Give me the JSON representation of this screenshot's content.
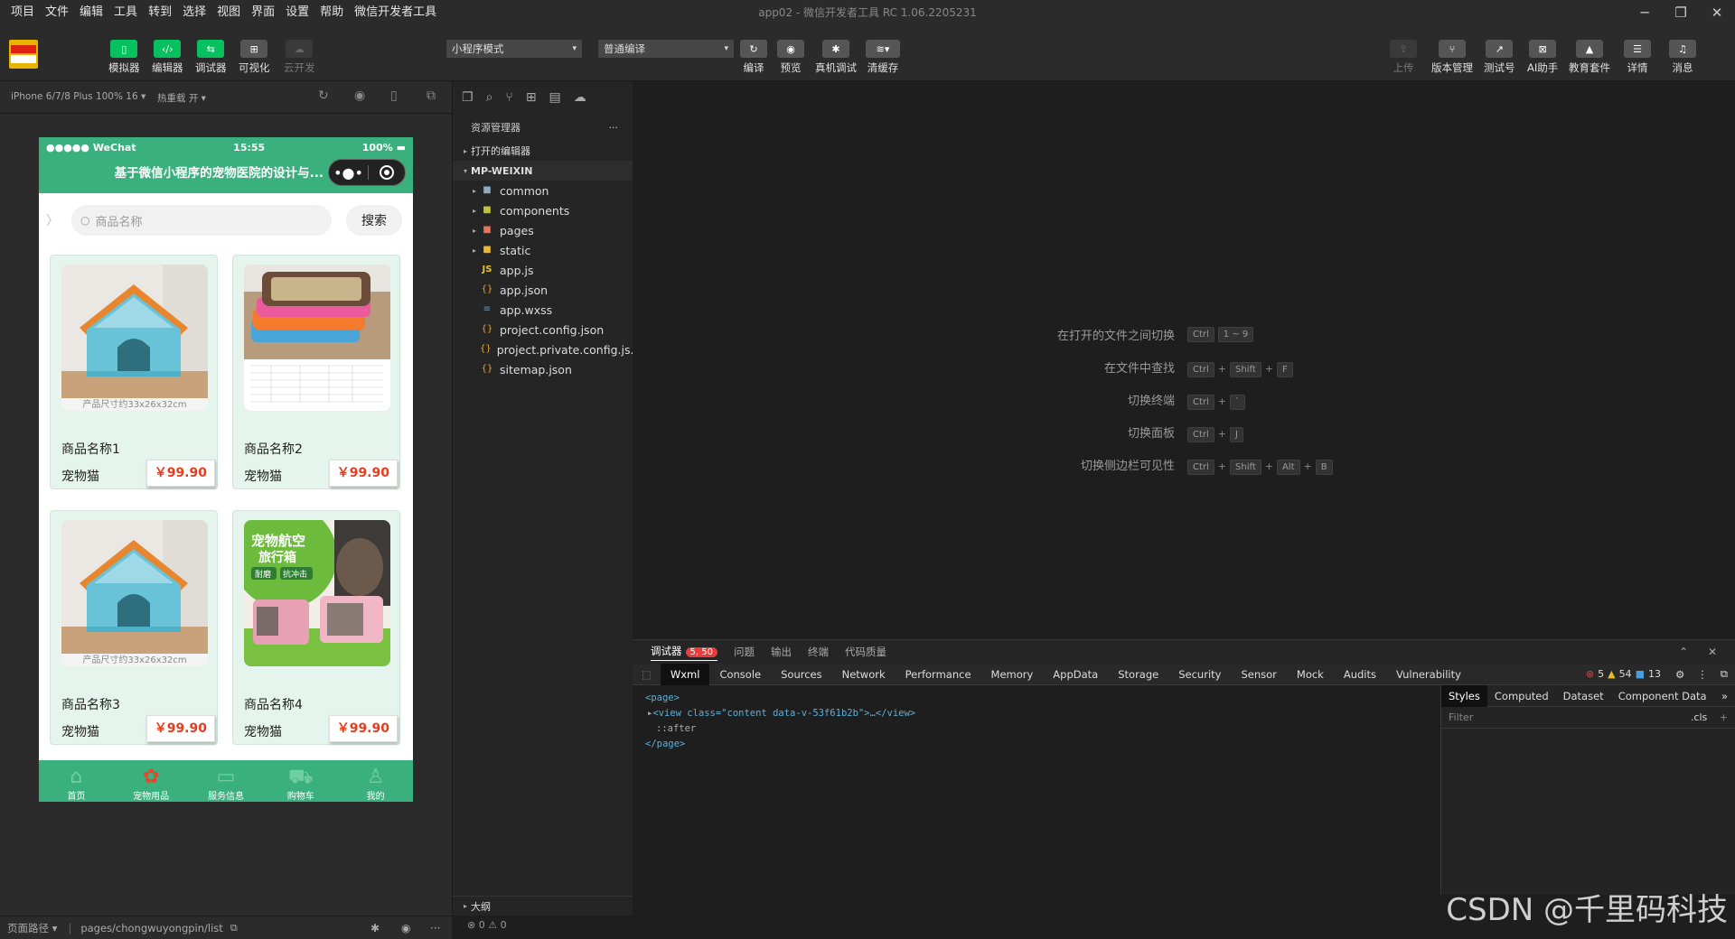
{
  "menubar": {
    "items": [
      "项目",
      "文件",
      "编辑",
      "工具",
      "转到",
      "选择",
      "视图",
      "界面",
      "设置",
      "帮助",
      "微信开发者工具"
    ],
    "window_title": "app02 - 微信开发者工具 RC 1.06.2205231"
  },
  "toolbar": {
    "left_buttons": [
      {
        "label": "模拟器",
        "icon": "phone-icon"
      },
      {
        "label": "编辑器",
        "icon": "code-icon"
      },
      {
        "label": "调试器",
        "icon": "debug-icon"
      },
      {
        "label": "可视化",
        "icon": "layout-icon"
      },
      {
        "label": "云开发",
        "icon": "cloud-icon"
      }
    ],
    "mode_select": "小程序模式",
    "compile_select": "普通编译",
    "mid_buttons": [
      {
        "label": "编译",
        "icon": "refresh-icon"
      },
      {
        "label": "预览",
        "icon": "eye-icon"
      },
      {
        "label": "真机调试",
        "icon": "bug-icon"
      },
      {
        "label": "清缓存",
        "icon": "layers-icon"
      }
    ],
    "right_buttons": [
      {
        "label": "上传",
        "icon": "upload-icon"
      },
      {
        "label": "版本管理",
        "icon": "branch-icon"
      },
      {
        "label": "测试号",
        "icon": "external-icon"
      },
      {
        "label": "AI助手",
        "icon": "ai-icon"
      },
      {
        "label": "教育套件",
        "icon": "graduation-icon"
      },
      {
        "label": "详情",
        "icon": "menu-icon"
      },
      {
        "label": "消息",
        "icon": "bell-icon"
      }
    ]
  },
  "simulator": {
    "device": "iPhone 6/7/8 Plus 100% 16",
    "hot_reload": "热重载 开",
    "status": {
      "carrier": "●●●●● WeChat",
      "time": "15:55",
      "battery": "100%"
    },
    "nav_title": "基于微信小程序的宠物医院的设计与...",
    "search_placeholder": "商品名称",
    "search_button": "搜索",
    "products": [
      {
        "name": "商品名称1",
        "category": "宠物猫",
        "price": "￥99.90"
      },
      {
        "name": "商品名称2",
        "category": "宠物猫",
        "price": "￥99.90"
      },
      {
        "name": "商品名称3",
        "category": "宠物猫",
        "price": "￥99.90"
      },
      {
        "name": "商品名称4",
        "category": "宠物猫",
        "price": "￥99.90"
      }
    ],
    "image_captions": [
      "产品尺寸约33x26x32cm",
      "产品尺寸约33x26x32cm"
    ],
    "promo_text": {
      "line1": "宠物航空",
      "line2": "旅行箱",
      "tag1": "耐磨",
      "tag2": "抗冲击"
    },
    "tabs": [
      {
        "label": "首页",
        "icon": "home-icon"
      },
      {
        "label": "宠物用品",
        "icon": "grid-icon"
      },
      {
        "label": "服务信息",
        "icon": "service-icon"
      },
      {
        "label": "购物车",
        "icon": "cart-icon"
      },
      {
        "label": "我的",
        "icon": "user-icon"
      }
    ]
  },
  "bottom": {
    "path_label": "页面路径",
    "path": "pages/chongwuyongpin/list",
    "errors": "⊗ 0 ⚠ 0"
  },
  "explorer": {
    "title": "资源管理器",
    "open_editors": "打开的编辑器",
    "project": "MP-WEIXIN",
    "folders": [
      "common",
      "components",
      "pages",
      "static"
    ],
    "files": [
      "app.js",
      "app.json",
      "app.wxss",
      "project.config.json",
      "project.private.config.js...",
      "sitemap.json"
    ],
    "outline": "大纲"
  },
  "shortcuts": [
    {
      "desc": "在打开的文件之间切换",
      "keys": [
        "Ctrl",
        "1 ~ 9"
      ]
    },
    {
      "desc": "在文件中查找",
      "keys": [
        "Ctrl",
        "+",
        "Shift",
        "+",
        "F"
      ]
    },
    {
      "desc": "切换终端",
      "keys": [
        "Ctrl",
        "+",
        "`"
      ]
    },
    {
      "desc": "切换面板",
      "keys": [
        "Ctrl",
        "+",
        "J"
      ]
    },
    {
      "desc": "切换侧边栏可见性",
      "keys": [
        "Ctrl",
        "+",
        "Shift",
        "+",
        "Alt",
        "+",
        "B"
      ]
    }
  ],
  "debugger": {
    "tabs": [
      "调试器",
      "问题",
      "输出",
      "终端",
      "代码质量"
    ],
    "badge": "5, 50",
    "devtools_tabs": [
      "Wxml",
      "Console",
      "Sources",
      "Network",
      "Performance",
      "Memory",
      "AppData",
      "Storage",
      "Security",
      "Sensor",
      "Mock",
      "Audits",
      "Vulnerability"
    ],
    "counts": {
      "errors": "5",
      "warnings": "54",
      "info": "13"
    },
    "dom_lines": [
      "<page>",
      "<view class=\"content data-v-53f61b2b\">…</view>",
      "::after",
      "</page>"
    ],
    "style_tabs": [
      "Styles",
      "Computed",
      "Dataset",
      "Component Data"
    ],
    "filter_placeholder": "Filter",
    "cls": ".cls"
  },
  "watermark": "CSDN @千里码科技",
  "colors": {
    "brand_green": "#3bb07f",
    "accent_green": "#07c160",
    "price_red": "#e83c1e"
  }
}
